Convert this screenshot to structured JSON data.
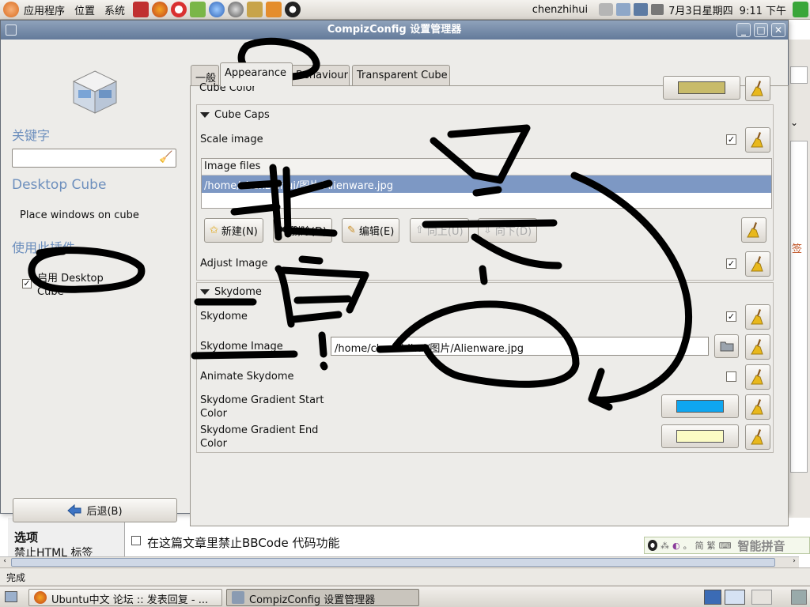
{
  "top_panel": {
    "menus": [
      "应用程序",
      "位置",
      "系统"
    ],
    "user": "chenzhihui",
    "date": "7月3日星期四",
    "time": "9:11 下午"
  },
  "window": {
    "title": "CompizConfig 设置管理器"
  },
  "sidebar": {
    "search_heading": "关键字",
    "search_value": "",
    "plugin_title": "Desktop Cube",
    "plugin_description": "Place windows on cube",
    "enable_heading": "使用此插件",
    "enable_label": "启用 Desktop Cube",
    "enable_checked": true,
    "back_label": "后退(B)"
  },
  "tabs": [
    "一般",
    "Appearance",
    "Behaviour",
    "Transparent Cube"
  ],
  "active_tab": "Appearance",
  "appearance": {
    "cube_color_label": "Cube Color",
    "cube_color": "#c8bb6a",
    "caps_section": "Cube Caps",
    "scale_image_label": "Scale image",
    "scale_image_checked": true,
    "image_files_header": "Image files",
    "image_files": [
      "/home/chenzhihui/图片/Alienware.jpg"
    ],
    "buttons": {
      "new": "新建(N)",
      "delete": "删除(D)",
      "edit": "编辑(E)",
      "up": "向上(U)",
      "down": "向下(D)"
    },
    "adjust_image_label": "Adjust Image",
    "adjust_image_checked": true,
    "skydome_section": "Skydome",
    "skydome_label": "Skydome",
    "skydome_checked": true,
    "skydome_image_label": "Skydome Image",
    "skydome_image_value": "/home/chenzhihui/图片/Alienware.jpg",
    "animate_skydome_label": "Animate Skydome",
    "animate_skydome_checked": false,
    "gradient_start_label": "Skydome Gradient Start Color",
    "gradient_start_color": "#0fa6f0",
    "gradient_end_label": "Skydome Gradient End Color",
    "gradient_end_color": "#fbfbc4"
  },
  "background": {
    "options_heading": "选项",
    "html_option": "禁止HTML 标签",
    "bbcode_option": "在这篇文章里禁止BBCode 代码功能",
    "side_char": "签",
    "status": "完成",
    "ime_name": "智能拼音"
  },
  "taskbar": {
    "items": [
      "Ubuntu中文 论坛 :: 发表回复 - ...",
      "CompizConfig 设置管理器"
    ]
  }
}
